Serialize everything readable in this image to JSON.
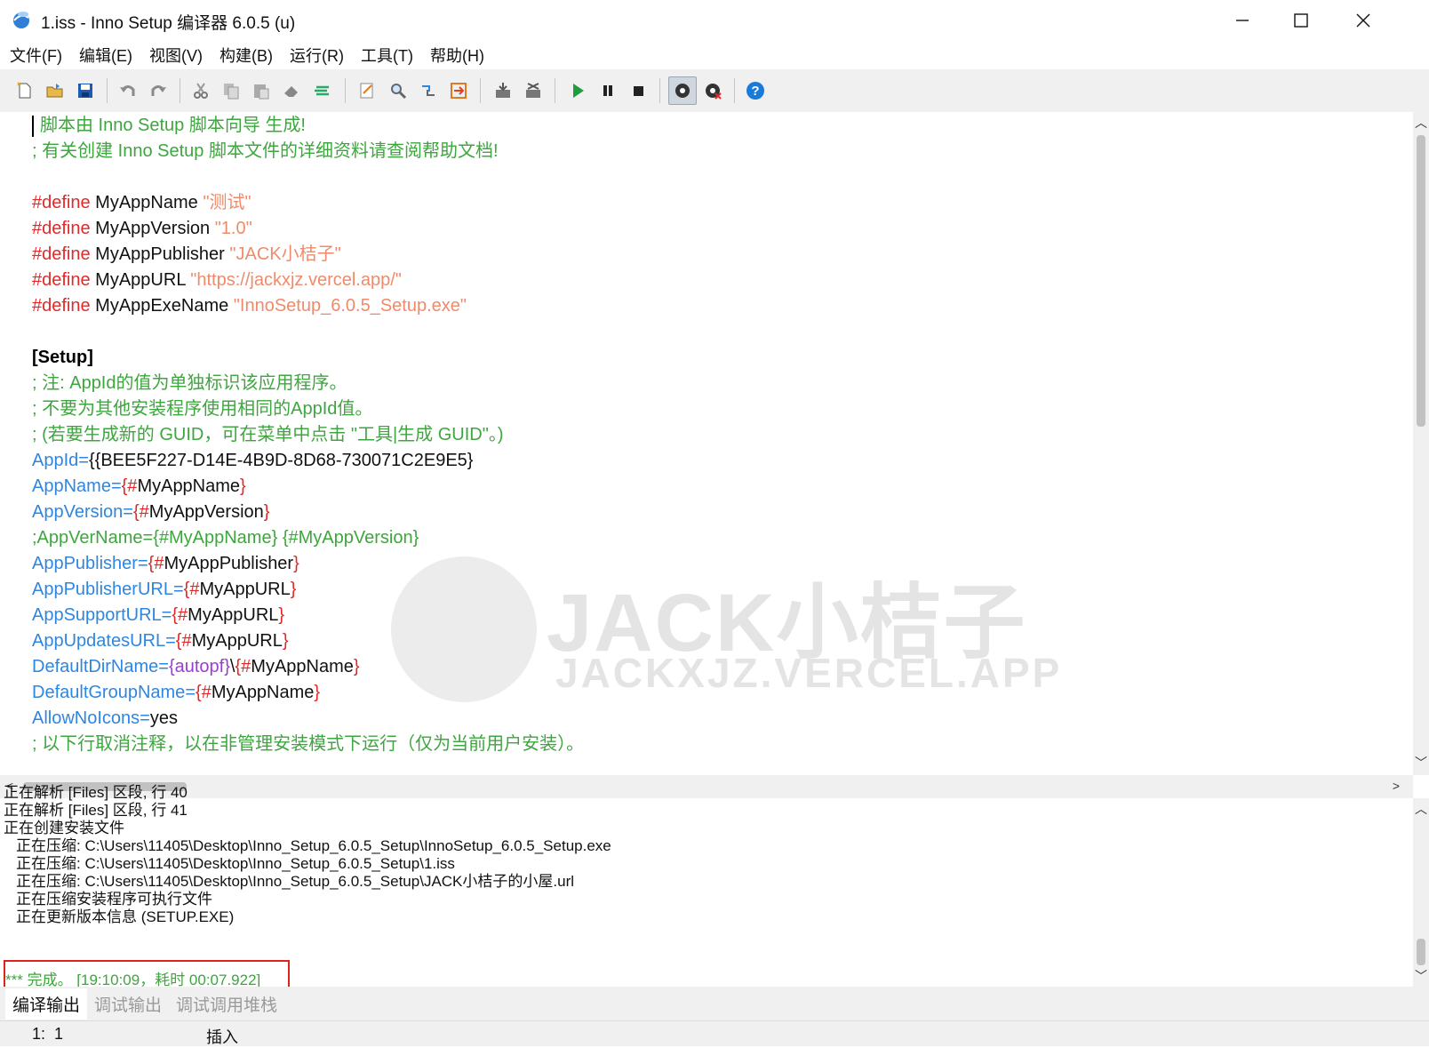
{
  "window": {
    "title": "1.iss - Inno Setup 编译器 6.0.5 (u)",
    "minimize_label": "─",
    "maximize_label": "☐",
    "close_label": "✕"
  },
  "menu": [
    "文件(F)",
    "编辑(E)",
    "视图(V)",
    "构建(B)",
    "运行(R)",
    "工具(T)",
    "帮助(H)"
  ],
  "toolbar_icons": [
    "new-file-icon",
    "open-folder-icon",
    "save-icon",
    "undo-icon",
    "redo-icon",
    "cut-icon",
    "copy-icon",
    "paste-icon",
    "erase-icon",
    "indent-icon",
    "find-icon",
    "find-next-icon",
    "replace-icon",
    "goto-icon",
    "compile-icon",
    "stop-compile-icon",
    "run-icon",
    "pause-icon",
    "stop-icon",
    "debug-target-icon",
    "debug-target-off-icon",
    "help-icon"
  ],
  "editor": {
    "lines": [
      [
        {
          "t": "脚本由 Inno Setup 脚本向导 生成!",
          "c": "comment"
        }
      ],
      [
        {
          "t": "; 有关创建 Inno Setup 脚本文件的详细资料请查阅帮助文档!",
          "c": "comment"
        }
      ],
      [],
      [
        {
          "t": "#define",
          "c": "define"
        },
        {
          "t": " MyAppName ",
          "c": "plain"
        },
        {
          "t": "\"测试\"",
          "c": "string"
        }
      ],
      [
        {
          "t": "#define",
          "c": "define"
        },
        {
          "t": " MyAppVersion ",
          "c": "plain"
        },
        {
          "t": "\"1.0\"",
          "c": "string"
        }
      ],
      [
        {
          "t": "#define",
          "c": "define"
        },
        {
          "t": " MyAppPublisher ",
          "c": "plain"
        },
        {
          "t": "\"JACK小桔子\"",
          "c": "string"
        }
      ],
      [
        {
          "t": "#define",
          "c": "define"
        },
        {
          "t": " MyAppURL ",
          "c": "plain"
        },
        {
          "t": "\"https://jackxjz.vercel.app/\"",
          "c": "string"
        }
      ],
      [
        {
          "t": "#define",
          "c": "define"
        },
        {
          "t": " MyAppExeName ",
          "c": "plain"
        },
        {
          "t": "\"InnoSetup_6.0.5_Setup.exe\"",
          "c": "string"
        }
      ],
      [],
      [
        {
          "t": "[Setup]",
          "c": "bold"
        }
      ],
      [
        {
          "t": "; 注: AppId的值为单独标识该应用程序。",
          "c": "comment"
        }
      ],
      [
        {
          "t": "; 不要为其他安装程序使用相同的AppId值。",
          "c": "comment"
        }
      ],
      [
        {
          "t": "; (若要生成新的 GUID，可在菜单中点击 \"工具|生成 GUID\"。)",
          "c": "comment"
        }
      ],
      [
        {
          "t": "AppId",
          "c": "key"
        },
        {
          "t": "=",
          "c": "key"
        },
        {
          "t": "{{BEE5F227-D14E-4B9D-8D68-730071C2E9E5}",
          "c": "plain"
        }
      ],
      [
        {
          "t": "AppName",
          "c": "key"
        },
        {
          "t": "=",
          "c": "key"
        },
        {
          "t": "{#",
          "c": "brace"
        },
        {
          "t": "MyAppName",
          "c": "plain"
        },
        {
          "t": "}",
          "c": "brace"
        }
      ],
      [
        {
          "t": "AppVersion",
          "c": "key"
        },
        {
          "t": "=",
          "c": "key"
        },
        {
          "t": "{#",
          "c": "brace"
        },
        {
          "t": "MyAppVersion",
          "c": "plain"
        },
        {
          "t": "}",
          "c": "brace"
        }
      ],
      [
        {
          "t": ";AppVerName={#MyAppName} {#MyAppVersion}",
          "c": "comment"
        }
      ],
      [
        {
          "t": "AppPublisher",
          "c": "key"
        },
        {
          "t": "=",
          "c": "key"
        },
        {
          "t": "{#",
          "c": "brace"
        },
        {
          "t": "MyAppPublisher",
          "c": "plain"
        },
        {
          "t": "}",
          "c": "brace"
        }
      ],
      [
        {
          "t": "AppPublisherURL",
          "c": "key"
        },
        {
          "t": "=",
          "c": "key"
        },
        {
          "t": "{#",
          "c": "brace"
        },
        {
          "t": "MyAppURL",
          "c": "plain"
        },
        {
          "t": "}",
          "c": "brace"
        }
      ],
      [
        {
          "t": "AppSupportURL",
          "c": "key"
        },
        {
          "t": "=",
          "c": "key"
        },
        {
          "t": "{#",
          "c": "brace"
        },
        {
          "t": "MyAppURL",
          "c": "plain"
        },
        {
          "t": "}",
          "c": "brace"
        }
      ],
      [
        {
          "t": "AppUpdatesURL",
          "c": "key"
        },
        {
          "t": "=",
          "c": "key"
        },
        {
          "t": "{#",
          "c": "brace"
        },
        {
          "t": "MyAppURL",
          "c": "plain"
        },
        {
          "t": "}",
          "c": "brace"
        }
      ],
      [
        {
          "t": "DefaultDirName",
          "c": "key"
        },
        {
          "t": "=",
          "c": "key"
        },
        {
          "t": "{autopf}",
          "c": "const"
        },
        {
          "t": "\\",
          "c": "plain"
        },
        {
          "t": "{#",
          "c": "brace"
        },
        {
          "t": "MyAppName",
          "c": "plain"
        },
        {
          "t": "}",
          "c": "brace"
        }
      ],
      [
        {
          "t": "DefaultGroupName",
          "c": "key"
        },
        {
          "t": "=",
          "c": "key"
        },
        {
          "t": "{#",
          "c": "brace"
        },
        {
          "t": "MyAppName",
          "c": "plain"
        },
        {
          "t": "}",
          "c": "brace"
        }
      ],
      [
        {
          "t": "AllowNoIcons",
          "c": "key"
        },
        {
          "t": "=",
          "c": "key"
        },
        {
          "t": "yes",
          "c": "plain"
        }
      ],
      [
        {
          "t": "; 以下行取消注释，以在非管理安装模式下运行（仅为当前用户安装）。",
          "c": "comment"
        }
      ]
    ]
  },
  "watermark": {
    "title": "JACK小桔子",
    "subtitle": "JACKXJZ.VERCEL.APP"
  },
  "output": {
    "lines": [
      {
        "t": "正在解析 [Files] 区段, 行 40",
        "indent": false
      },
      {
        "t": "正在解析 [Files] 区段, 行 41",
        "indent": false
      },
      {
        "t": "正在创建安装文件",
        "indent": false
      },
      {
        "t": "正在压缩: C:\\Users\\11405\\Desktop\\Inno_Setup_6.0.5_Setup\\InnoSetup_6.0.5_Setup.exe",
        "indent": true
      },
      {
        "t": "正在压缩: C:\\Users\\11405\\Desktop\\Inno_Setup_6.0.5_Setup\\1.iss",
        "indent": true
      },
      {
        "t": "正在压缩: C:\\Users\\11405\\Desktop\\Inno_Setup_6.0.5_Setup\\JACK小桔子的小屋.url",
        "indent": true
      },
      {
        "t": "正在压缩安装程序可执行文件",
        "indent": true
      },
      {
        "t": "正在更新版本信息 (SETUP.EXE)",
        "indent": true
      }
    ],
    "done": "*** 完成。 [19:10:09，耗时 00:07.922]"
  },
  "tabs": [
    "编译输出",
    "调试输出",
    "调试调用堆栈"
  ],
  "status": {
    "line": "1",
    "column": "1",
    "mode": "插入"
  },
  "colors": {
    "comment": "#3ea63e",
    "define": "#e02a2a",
    "string": "#f08a6a",
    "key": "#2e86e0",
    "const": "#9b3ad6",
    "highlight_box": "#e0221e"
  }
}
